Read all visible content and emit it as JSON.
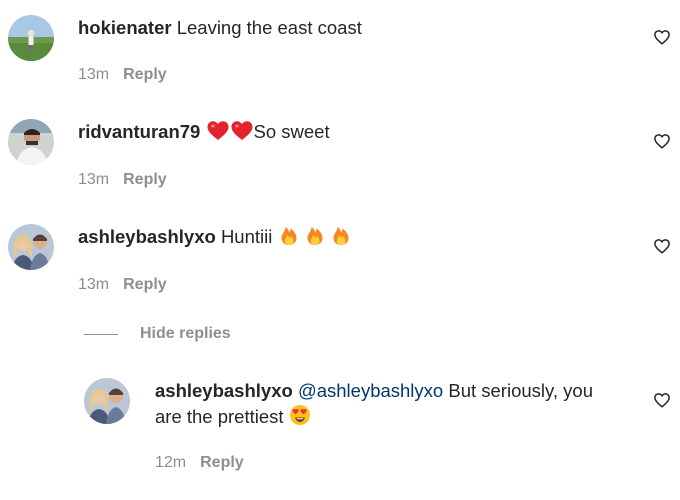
{
  "comments": [
    {
      "username": "hokienater",
      "text": "Leaving the east coast",
      "time": "13m",
      "reply_label": "Reply"
    },
    {
      "username": "ridvanturan79",
      "emoji": "❤️❤️",
      "text": "So sweet",
      "time": "13m",
      "reply_label": "Reply"
    },
    {
      "username": "ashleybashlyxo",
      "text": "Huntiii",
      "emoji": "🔥🔥🔥",
      "time": "13m",
      "reply_label": "Reply"
    }
  ],
  "hide_replies_label": "Hide replies",
  "reply": {
    "username": "ashleybashlyxo",
    "mention": "@ashleybashlyxo",
    "text_line1": "But seriously, you",
    "text_line2": "are the prettiest",
    "emoji": "😍",
    "time": "12m",
    "reply_label": "Reply"
  },
  "icons": {
    "like": "heart-outline-icon"
  },
  "colors": {
    "text": "#262626",
    "secondary": "#8e8e8e",
    "mention": "#00376b"
  }
}
